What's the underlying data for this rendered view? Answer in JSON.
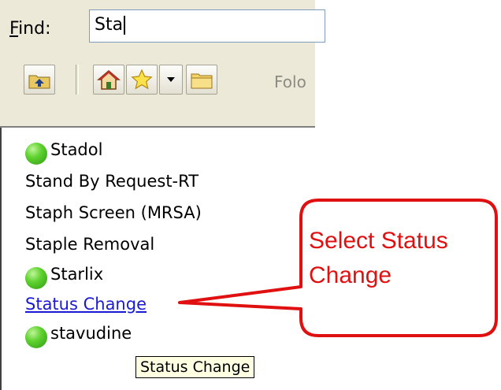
{
  "find": {
    "label_prefix": "F",
    "label_rest": "ind:",
    "value": "Sta"
  },
  "toolbar": {
    "up_icon": "up-folder-icon",
    "home_icon": "home-icon",
    "favorites_icon": "star-icon",
    "dropdown_icon": "chevron-down-icon",
    "folder_icon": "folder-icon",
    "folders_label": "Folo"
  },
  "results": {
    "items": [
      {
        "label": "Stadol",
        "icon": "green-dot-icon"
      },
      {
        "label": "Stand By Request-RT"
      },
      {
        "label": "Staph Screen (MRSA)"
      },
      {
        "label": "Staple Removal"
      },
      {
        "label": "Starlix",
        "icon": "green-dot-icon"
      },
      {
        "label": "Status Change"
      },
      {
        "label": "stavudine",
        "icon": "green-dot-icon"
      }
    ]
  },
  "tooltip": {
    "text": "Status Change"
  },
  "callout": {
    "line1": "Select Status",
    "line2": "Change",
    "color": "#e01010"
  }
}
